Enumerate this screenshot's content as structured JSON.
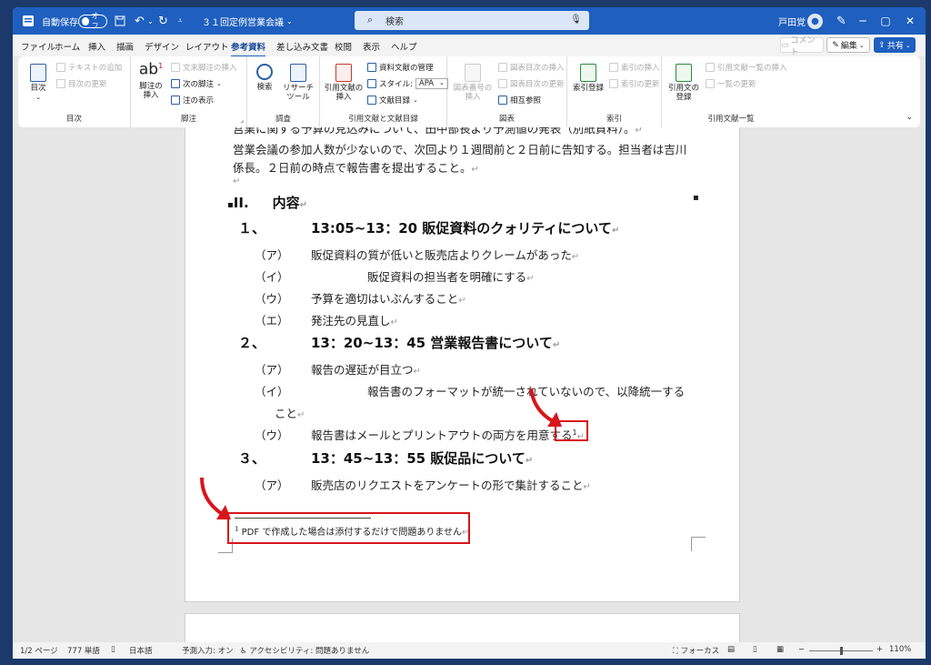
{
  "titlebar": {
    "autosave_label": "自動保存",
    "autosave_state": "オフ",
    "doc_title": "３１回定例営業会議",
    "search_placeholder": "検索",
    "user_name": "戸田覚"
  },
  "menu": {
    "tabs": [
      "ファイル",
      "ホーム",
      "挿入",
      "描画",
      "デザイン",
      "レイアウト",
      "参考資料",
      "差し込み文書",
      "校閲",
      "表示",
      "ヘルプ"
    ],
    "active_tab": "参考資料",
    "comment_label": "コメント",
    "edit_label": "編集",
    "share_label": "共有"
  },
  "ribbon": {
    "toc": {
      "big": "目次",
      "small1": "テキストの追加",
      "small2": "目次の更新",
      "label": "目次"
    },
    "footnote": {
      "big1": "脚注の\n挿入",
      "small1": "文末脚注の挿入",
      "small2": "次の脚注",
      "small3": "注の表示",
      "label": "脚注"
    },
    "research": {
      "big1": "検索",
      "big2": "リサーチ\nツール",
      "label": "調査"
    },
    "citations": {
      "big1": "引用文献の\n挿入",
      "small1": "資料文献の管理",
      "small2": "スタイル:",
      "style_value": "APA",
      "small3": "文献目録",
      "label": "引用文献と文献目録"
    },
    "captions": {
      "big1": "図表番号の\n挿入",
      "small1": "図表目次の挿入",
      "small2": "図表目次の更新",
      "small3": "相互参照",
      "label": "図表"
    },
    "index": {
      "big1": "索引登録",
      "small1": "索引の挿入",
      "small2": "索引の更新",
      "label": "索引"
    },
    "authorities": {
      "big1": "引用文の\n登録",
      "small1": "引用文献一覧の挿入",
      "small2": "一覧の更新",
      "label": "引用文献一覧"
    }
  },
  "doc": {
    "line_top_partial": "営業に関する予算の見込みについて、田中部長より予測値の発表（別紙資料）。",
    "para1_a": "営業会議の参加人数が少ないので、次回より１週間前と２日前に告知する。担当者は吉川",
    "para1_b": "係長。２日前の時点で報告書を提出すること。",
    "section_num": "II.",
    "section_title": "内容",
    "items": [
      {
        "num": "１、",
        "title": "13:05~13：20 販促資料のクォリティについて",
        "subs": [
          {
            "mark": "（ア）",
            "text": "販促資料の質が低いと販売店よりクレームがあった"
          },
          {
            "mark": "（イ）",
            "text": "販促資料の担当者を明確にする"
          },
          {
            "mark": "（ウ）",
            "text": "予算を適切はいぶんすること"
          },
          {
            "mark": "（エ）",
            "text": "発注先の見直し"
          }
        ]
      },
      {
        "num": "２、",
        "title": "13：20~13：45 営業報告書について",
        "subs": [
          {
            "mark": "（ア）",
            "text": "報告の遅延が目立つ"
          },
          {
            "mark": "（イ）",
            "text": "報告書のフォーマットが統一されていないので、以降統一する"
          },
          {
            "mark": "",
            "text": "こと"
          },
          {
            "mark": "（ウ）",
            "text": "報告書はメールとプリントアウトの両方を用意する"
          }
        ]
      },
      {
        "num": "３、",
        "title": "13：45~13：55 販促品について",
        "subs": [
          {
            "mark": "（ア）",
            "text": "販売店のリクエストをアンケートの形で集計すること"
          }
        ]
      }
    ],
    "footnote_ref": "1",
    "footnote_text": "PDF で作成した場合は添付するだけで問題ありません"
  },
  "status": {
    "page": "1/2 ページ",
    "words": "777 単語",
    "lang": "日本語",
    "predict": "予測入力: オン",
    "access": "アクセシビリティ: 問題ありません",
    "focus": "フォーカス",
    "zoom": "110%"
  },
  "colors": {
    "accent": "#1e5fbf",
    "highlight": "#d8141c"
  }
}
